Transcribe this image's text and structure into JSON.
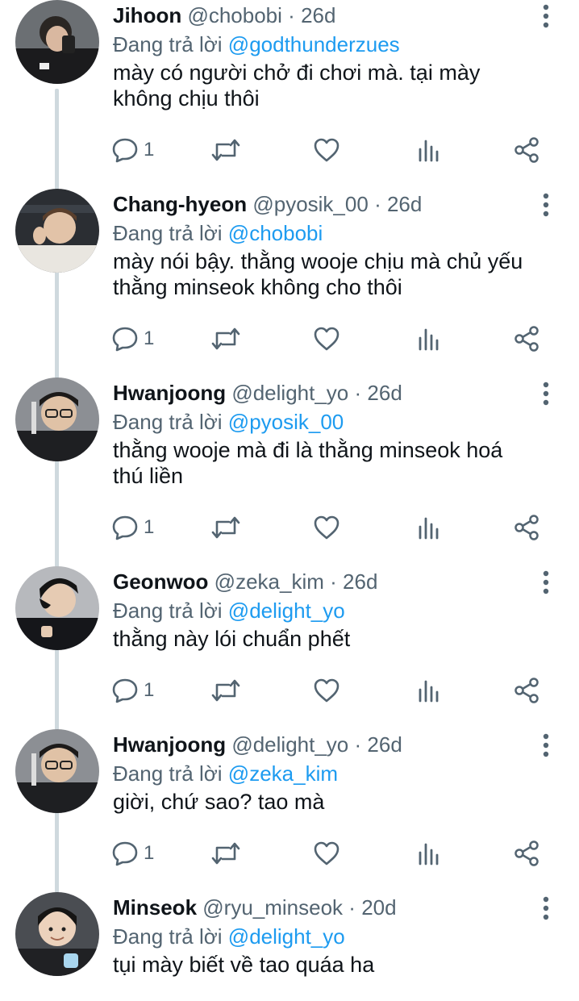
{
  "ui": {
    "accent_color": "#1d9bf0",
    "text_color": "#0f1419",
    "muted_color": "#536471",
    "icons": {
      "more": "three-dots-vertical-icon",
      "reply": "speech-bubble-icon",
      "retweet": "retweet-arrows-icon",
      "like": "heart-icon",
      "views": "bar-chart-icon",
      "share": "share-nodes-icon"
    }
  },
  "tweets": [
    {
      "name": "Jihoon",
      "handle": "@chobobi",
      "separator": "·",
      "time": "26d",
      "reply_prefix": "Đang trả lời",
      "reply_to": "@godthunderzues",
      "text": "mày có người chở đi chơi mà. tại mày không chịu thôi",
      "reply_count": "1"
    },
    {
      "name": "Chang-hyeon",
      "handle": "@pyosik_00",
      "separator": "·",
      "time": "26d",
      "reply_prefix": "Đang trả lời",
      "reply_to": "@chobobi",
      "text": "mày nói bậy. thằng wooje chịu mà chủ yếu thằng minseok không cho thôi",
      "reply_count": "1"
    },
    {
      "name": "Hwanjoong",
      "handle": "@delight_yo",
      "separator": "·",
      "time": "26d",
      "reply_prefix": "Đang trả lời",
      "reply_to": "@pyosik_00",
      "text": "thằng wooje mà đi là thằng minseok hoá thú liền",
      "reply_count": "1"
    },
    {
      "name": "Geonwoo",
      "handle": "@zeka_kim",
      "separator": "·",
      "time": "26d",
      "reply_prefix": "Đang trả lời",
      "reply_to": "@delight_yo",
      "text": "thằng này lói chuẩn phết",
      "reply_count": "1"
    },
    {
      "name": "Hwanjoong",
      "handle": "@delight_yo",
      "separator": "·",
      "time": "26d",
      "reply_prefix": "Đang trả lời",
      "reply_to": "@zeka_kim",
      "text": "giời, chứ sao? tao mà",
      "reply_count": "1"
    },
    {
      "name": "Minseok",
      "handle": "@ryu_minseok",
      "separator": "·",
      "time": "20d",
      "reply_prefix": "Đang trả lời",
      "reply_to": "@delight_yo",
      "text": "tụi mày biết về tao quáa ha"
    }
  ]
}
